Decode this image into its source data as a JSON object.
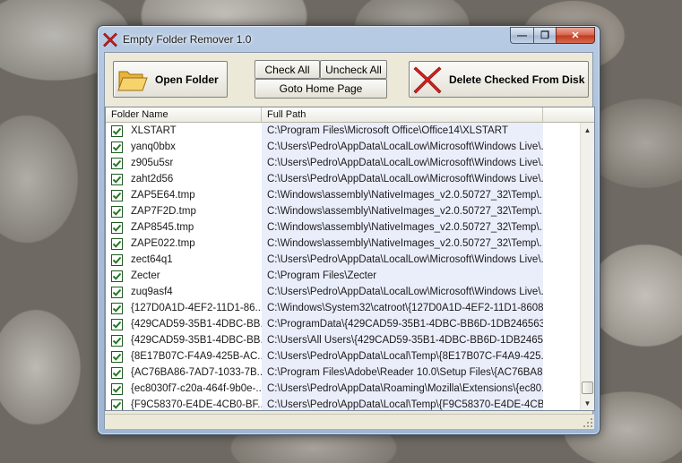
{
  "window": {
    "title": "Empty Folder Remover 1.0",
    "caption_buttons": {
      "minimize": "—",
      "maximize": "❐",
      "close": "✕"
    }
  },
  "toolbar": {
    "open_folder_label": "Open Folder",
    "check_all_label": "Check All",
    "uncheck_all_label": "Uncheck All",
    "goto_home_label": "Goto Home Page",
    "delete_label": "Delete Checked From Disk"
  },
  "list": {
    "columns": [
      "Folder Name",
      "Full Path"
    ],
    "rows": [
      {
        "name": "XLSTART",
        "path": "C:\\Program Files\\Microsoft Office\\Office14\\XLSTART",
        "checked": true
      },
      {
        "name": "yanq0bbx",
        "path": "C:\\Users\\Pedro\\AppData\\LocalLow\\Microsoft\\Windows Live\\...",
        "checked": true
      },
      {
        "name": "z905u5sr",
        "path": "C:\\Users\\Pedro\\AppData\\LocalLow\\Microsoft\\Windows Live\\...",
        "checked": true
      },
      {
        "name": "zaht2d56",
        "path": "C:\\Users\\Pedro\\AppData\\LocalLow\\Microsoft\\Windows Live\\...",
        "checked": true
      },
      {
        "name": "ZAP5E64.tmp",
        "path": "C:\\Windows\\assembly\\NativeImages_v2.0.50727_32\\Temp\\...",
        "checked": true
      },
      {
        "name": "ZAP7F2D.tmp",
        "path": "C:\\Windows\\assembly\\NativeImages_v2.0.50727_32\\Temp\\...",
        "checked": true
      },
      {
        "name": "ZAP8545.tmp",
        "path": "C:\\Windows\\assembly\\NativeImages_v2.0.50727_32\\Temp\\...",
        "checked": true
      },
      {
        "name": "ZAPE022.tmp",
        "path": "C:\\Windows\\assembly\\NativeImages_v2.0.50727_32\\Temp\\...",
        "checked": true
      },
      {
        "name": "zect64q1",
        "path": "C:\\Users\\Pedro\\AppData\\LocalLow\\Microsoft\\Windows Live\\...",
        "checked": true
      },
      {
        "name": "Zecter",
        "path": "C:\\Program Files\\Zecter",
        "checked": true
      },
      {
        "name": "zuq9asf4",
        "path": "C:\\Users\\Pedro\\AppData\\LocalLow\\Microsoft\\Windows Live\\...",
        "checked": true
      },
      {
        "name": "{127D0A1D-4EF2-11D1-86...",
        "path": "C:\\Windows\\System32\\catroot\\{127D0A1D-4EF2-11D1-8608-...",
        "checked": true
      },
      {
        "name": "{429CAD59-35B1-4DBC-BB...",
        "path": "C:\\ProgramData\\{429CAD59-35B1-4DBC-BB6D-1DB2465635...",
        "checked": true
      },
      {
        "name": "{429CAD59-35B1-4DBC-BB...",
        "path": "C:\\Users\\All Users\\{429CAD59-35B1-4DBC-BB6D-1DB24656...",
        "checked": true
      },
      {
        "name": "{8E17B07C-F4A9-425B-AC...",
        "path": "C:\\Users\\Pedro\\AppData\\Local\\Temp\\{8E17B07C-F4A9-425...",
        "checked": true
      },
      {
        "name": "{AC76BA86-7AD7-1033-7B...",
        "path": "C:\\Program Files\\Adobe\\Reader 10.0\\Setup Files\\{AC76BA86...",
        "checked": true
      },
      {
        "name": "{ec8030f7-c20a-464f-9b0e-...",
        "path": "C:\\Users\\Pedro\\AppData\\Roaming\\Mozilla\\Extensions\\{ec80...",
        "checked": true
      },
      {
        "name": "{F9C58370-E4DE-4CB0-BF...",
        "path": "C:\\Users\\Pedro\\AppData\\Local\\Temp\\{F9C58370-E4DE-4CB...",
        "checked": true
      }
    ]
  },
  "scrollbar": {
    "up_arrow": "▲",
    "down_arrow": "▼"
  },
  "icons": {
    "app": "red-x-icon",
    "open_folder": "folder-icon",
    "delete": "red-x-icon",
    "checkbox": "checkmark-icon"
  },
  "colors": {
    "accent_red": "#d42020",
    "checkbox_green": "#1e7a1e",
    "path_column_bg": "#eaeefb"
  }
}
